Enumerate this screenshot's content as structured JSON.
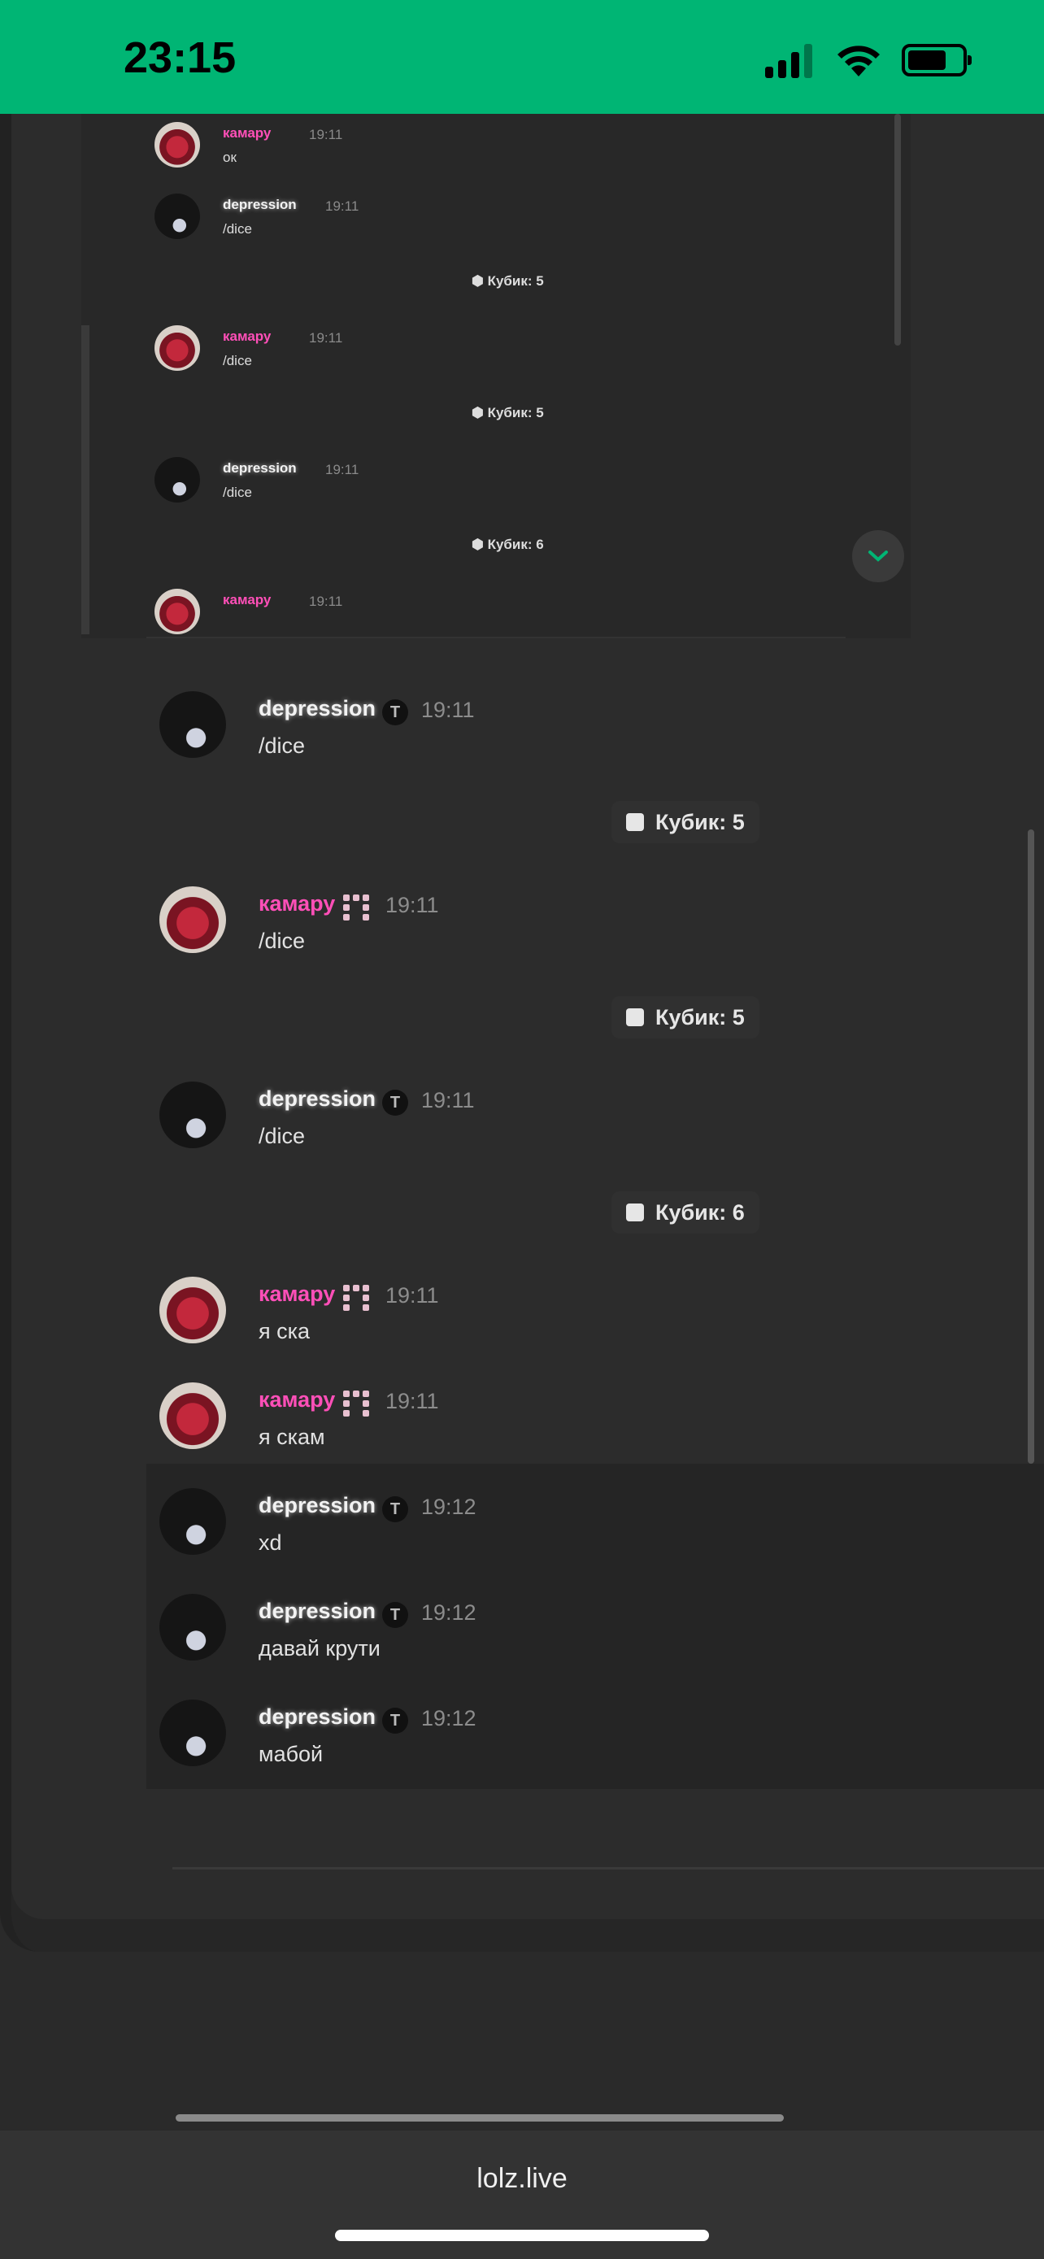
{
  "status_bar": {
    "time": "23:15"
  },
  "colors": {
    "status_bar": "#00b574",
    "name_pink": "#ff4fb8",
    "background": "#2a2a2a"
  },
  "mini_chat": {
    "messages": [
      {
        "name": "камару",
        "time": "19:11",
        "text": "ок",
        "avatar": "red-avatar"
      },
      {
        "name": "depression",
        "time": "19:11",
        "text": "/dice",
        "avatar": "dark-avatar"
      },
      {
        "dice": "Кубик: 5"
      },
      {
        "name": "камару",
        "time": "19:11",
        "text": "/dice",
        "avatar": "red-avatar"
      },
      {
        "dice": "Кубик: 5"
      },
      {
        "name": "depression",
        "time": "19:11",
        "text": "/dice",
        "avatar": "dark-avatar"
      },
      {
        "dice": "Кубик: 6"
      },
      {
        "name": "камару",
        "time": "19:11",
        "text": "",
        "avatar": "red-avatar"
      }
    ],
    "scroll_down_icon": "chevron-down-icon"
  },
  "chat": {
    "messages": [
      {
        "name": "depression",
        "time": "19:11",
        "text": "/dice"
      },
      {
        "dice": "Кубик: 5"
      },
      {
        "name": "камару",
        "time": "19:11",
        "text": "/dice"
      },
      {
        "dice": "Кубик: 5"
      },
      {
        "name": "depression",
        "time": "19:11",
        "text": "/dice"
      },
      {
        "dice": "Кубик: 6"
      },
      {
        "name": "камару",
        "time": "19:11",
        "text": "я ска"
      },
      {
        "name": "камару",
        "time": "19:11",
        "text": "я скам"
      },
      {
        "name": "depression",
        "time": "19:12",
        "text": "xd"
      },
      {
        "name": "depression",
        "time": "19:12",
        "text": "давай крути"
      },
      {
        "name": "depression",
        "time": "19:12",
        "text": "мабой"
      }
    ],
    "badge_t": "T"
  },
  "browser": {
    "url": "lolz.live"
  }
}
